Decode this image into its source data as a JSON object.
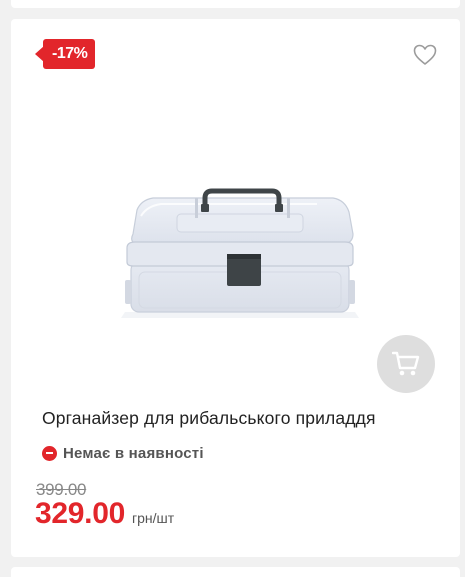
{
  "product": {
    "discount_badge": "-17%",
    "title": "Органайзер для рибальського приладдя",
    "stock_status": "Немає в наявності",
    "old_price": "399.00",
    "price": "329.00",
    "price_unit": "грн/шт",
    "image_alt": "plastic-organizer-box",
    "icons": {
      "wishlist": "heart-icon",
      "cart": "cart-icon",
      "stock": "minus-circle-icon"
    }
  },
  "colors": {
    "accent": "#e2262b",
    "text": "#222222",
    "muted": "#888888",
    "cart_bg": "#dedede"
  }
}
